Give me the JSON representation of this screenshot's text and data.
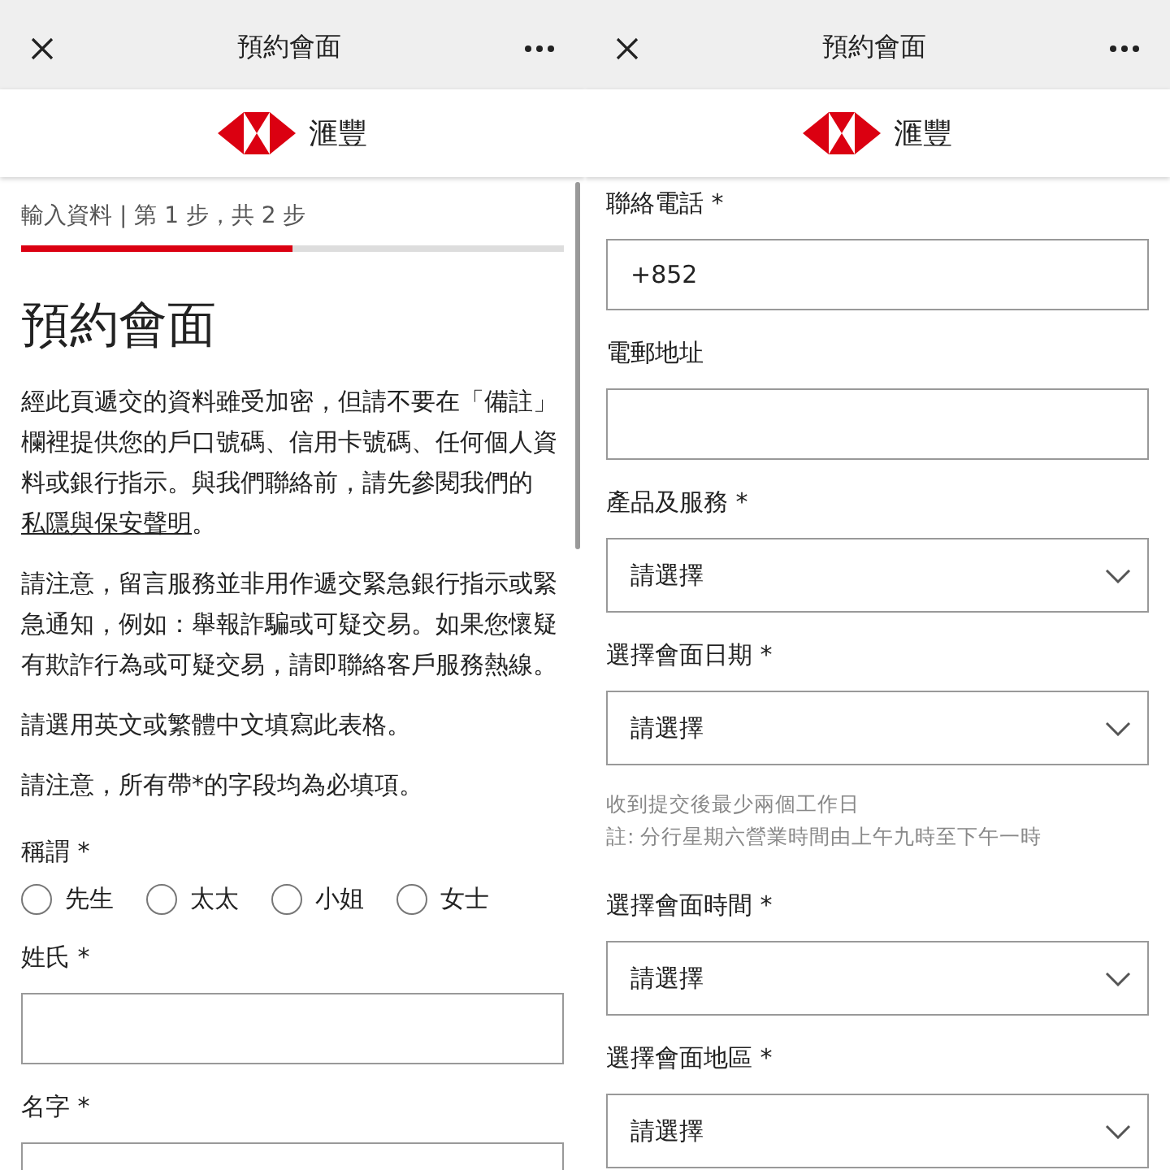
{
  "panels": [
    {
      "header": {
        "title": "預約會面"
      },
      "brand": {
        "name": "滙豐"
      },
      "blocks": [
        {
          "kind": "progress",
          "text": "輸入資料 | 第 1 步，共 2 步",
          "level": 0.5
        },
        {
          "kind": "heading",
          "text": "預約會面"
        },
        {
          "kind": "paragraph",
          "parts": [
            {
              "kind": "text",
              "text": "經此頁遞交的資料雖受加密，但請不要在「備註」欄裡提供您的戶口號碼、信用卡號碼、任何個人資料或銀行指示。與我們聯絡前，請先參閱我們的"
            },
            {
              "kind": "link",
              "text": "私隱與保安聲明"
            },
            {
              "kind": "text",
              "text": "。"
            }
          ]
        },
        {
          "kind": "paragraph",
          "parts": [
            {
              "kind": "text",
              "text": "請注意，留言服務並非用作遞交緊急銀行指示或緊急通知，例如：舉報詐騙或可疑交易。如果您懷疑有欺詐行為或可疑交易，請即聯絡客戶服務熱線。"
            }
          ]
        },
        {
          "kind": "paragraph",
          "parts": [
            {
              "kind": "text",
              "text": "請選用英文或繁體中文填寫此表格。"
            }
          ]
        },
        {
          "kind": "paragraph",
          "parts": [
            {
              "kind": "text",
              "text": "請注意，所有帶*的字段均為必填項。"
            }
          ]
        },
        {
          "kind": "radio_group",
          "label": "稱謂 *",
          "options": [
            {
              "label": "先生",
              "selected": false
            },
            {
              "label": "太太",
              "selected": false
            },
            {
              "label": "小姐",
              "selected": false
            },
            {
              "label": "女士",
              "selected": false
            }
          ]
        },
        {
          "kind": "text_field",
          "label": "姓氏 *"
        },
        {
          "kind": "text_field",
          "label": "名字 *"
        }
      ]
    },
    {
      "header": {
        "title": "預約會面"
      },
      "brand": {
        "name": "滙豐"
      },
      "blocks": [
        {
          "kind": "text_field",
          "label": "聯絡電話 *",
          "value": "+852"
        },
        {
          "kind": "text_field",
          "label": "電郵地址"
        },
        {
          "kind": "select",
          "label": "產品及服務 *",
          "value": "請選擇"
        },
        {
          "kind": "select",
          "label": "選擇會面日期 *",
          "value": "請選擇"
        },
        {
          "kind": "hint",
          "lines": [
            "收到提交後最少兩個工作日",
            "註: 分行星期六營業時間由上午九時至下午一時"
          ]
        },
        {
          "kind": "select",
          "label": "選擇會面時間 *",
          "value": "請選擇"
        },
        {
          "kind": "select",
          "label": "選擇會面地區 *",
          "value": "請選擇"
        }
      ]
    }
  ]
}
